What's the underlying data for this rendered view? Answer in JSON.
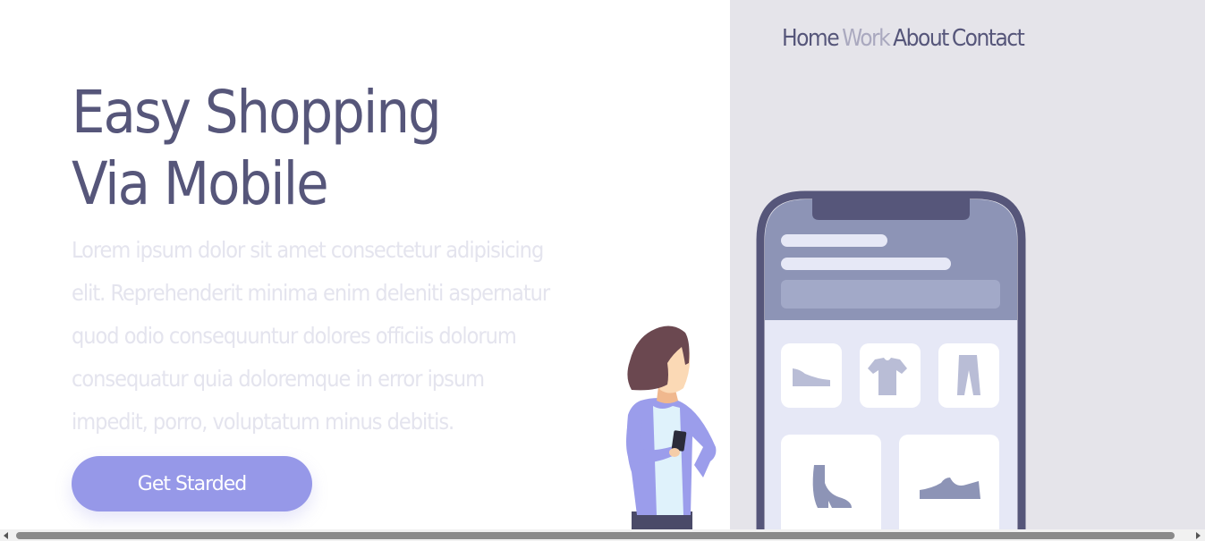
{
  "nav": {
    "items": [
      "Home",
      "Work",
      "About",
      "Contact"
    ],
    "active": "Work"
  },
  "hero": {
    "title_line1": "Easy Shopping",
    "title_line2": "Via Mobile",
    "description": "Lorem ipsum dolor sit amet consectetur adipisicing elit. Reprehenderit minima enim deleniti aspernatur quod odio consequuntur dolores officiis dolorum consequatur quia doloremque in error ipsum impedit, porro, voluptatum minus debitis.",
    "cta_label": "Get Starded"
  },
  "colors": {
    "primary_text": "#56567a",
    "nav_active": "#aaa9bf",
    "cta": "#9698e8",
    "panel_bg": "#e5e4ea",
    "phone_frame": "#56567a",
    "phone_header": "#8d94b6",
    "phone_body": "#e6e8f6"
  },
  "illustration": {
    "icons": [
      "shoe-icon",
      "tshirt-icon",
      "pants-icon",
      "boot-icon",
      "sneaker-icon"
    ]
  }
}
